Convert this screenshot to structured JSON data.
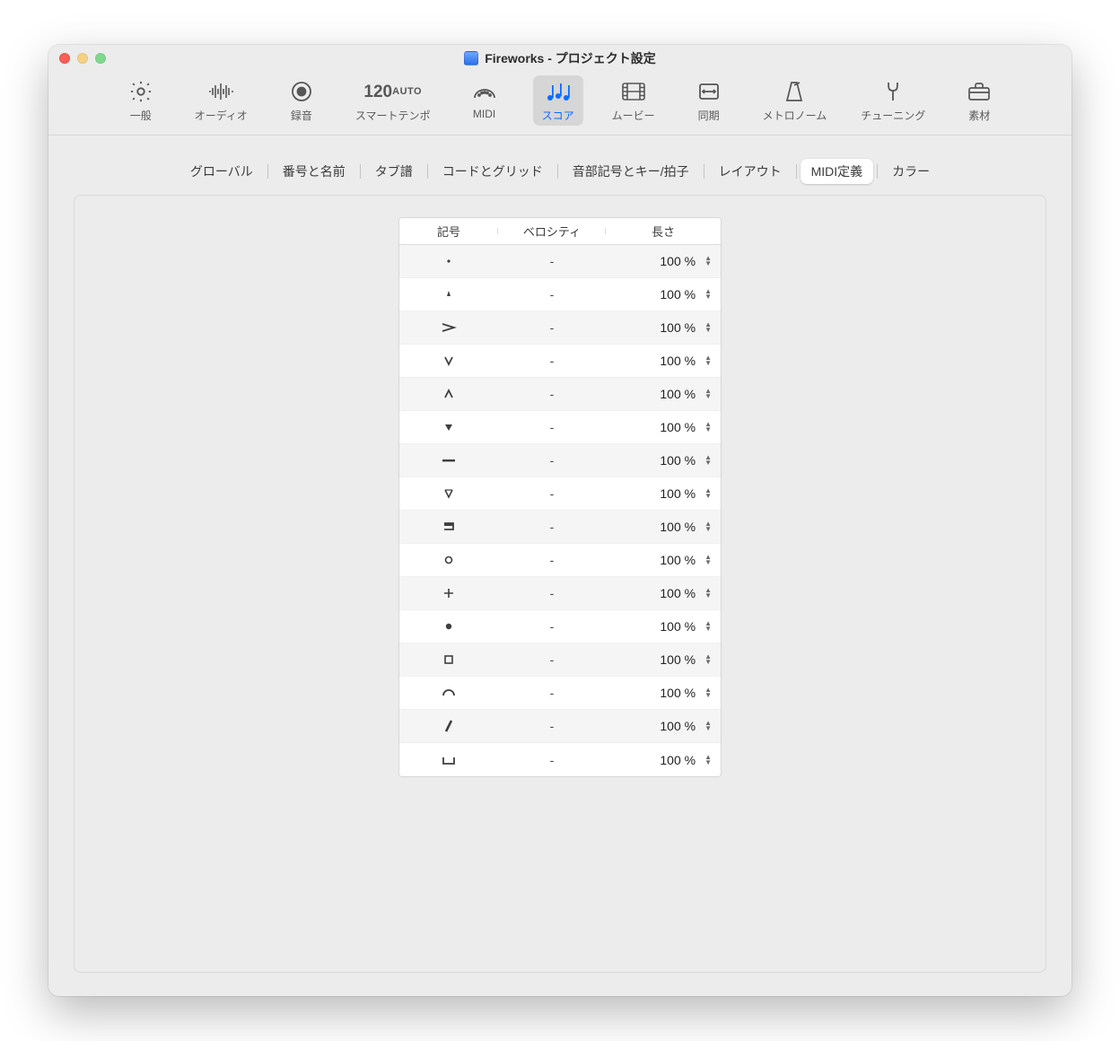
{
  "window": {
    "title": "Fireworks - プロジェクト設定"
  },
  "toolbar": {
    "items": [
      {
        "id": "general",
        "label": "一般"
      },
      {
        "id": "audio",
        "label": "オーディオ"
      },
      {
        "id": "record",
        "label": "録音"
      },
      {
        "id": "smart-tempo",
        "label": "スマートテンポ",
        "tempo": "120",
        "mode": "AUTO"
      },
      {
        "id": "midi",
        "label": "MIDI"
      },
      {
        "id": "score",
        "label": "スコア",
        "selected": true
      },
      {
        "id": "movie",
        "label": "ムービー"
      },
      {
        "id": "sync",
        "label": "同期"
      },
      {
        "id": "metronome",
        "label": "メトロノーム"
      },
      {
        "id": "tuning",
        "label": "チューニング"
      },
      {
        "id": "assets",
        "label": "素材"
      }
    ]
  },
  "subtabs": [
    {
      "label": "グローバル"
    },
    {
      "label": "番号と名前"
    },
    {
      "label": "タブ譜"
    },
    {
      "label": "コードとグリッド"
    },
    {
      "label": "音部記号とキー/拍子"
    },
    {
      "label": "レイアウト"
    },
    {
      "label": "MIDI定義",
      "active": true
    },
    {
      "label": "カラー"
    }
  ],
  "table": {
    "headers": {
      "symbol": "記号",
      "velocity": "ベロシティ",
      "length": "長さ"
    },
    "rows": [
      {
        "symbol": "staccato-dot",
        "velocity": "-",
        "length": "100 %"
      },
      {
        "symbol": "staccatissimo",
        "velocity": "-",
        "length": "100 %"
      },
      {
        "symbol": "accent",
        "velocity": "-",
        "length": "100 %"
      },
      {
        "symbol": "strong-accent-down",
        "velocity": "-",
        "length": "100 %"
      },
      {
        "symbol": "strong-accent-up",
        "velocity": "-",
        "length": "100 %"
      },
      {
        "symbol": "accent-filled-down",
        "velocity": "-",
        "length": "100 %"
      },
      {
        "symbol": "tenuto",
        "velocity": "-",
        "length": "100 %"
      },
      {
        "symbol": "down-bow-outline",
        "velocity": "-",
        "length": "100 %"
      },
      {
        "symbol": "down-bow",
        "velocity": "-",
        "length": "100 %"
      },
      {
        "symbol": "harmonic-circle",
        "velocity": "-",
        "length": "100 %"
      },
      {
        "symbol": "plus-stopped",
        "velocity": "-",
        "length": "100 %"
      },
      {
        "symbol": "filled-dot",
        "velocity": "-",
        "length": "100 %"
      },
      {
        "symbol": "open-square",
        "velocity": "-",
        "length": "100 %"
      },
      {
        "symbol": "fermata-arc",
        "velocity": "-",
        "length": "100 %"
      },
      {
        "symbol": "tremolo-slash",
        "velocity": "-",
        "length": "100 %"
      },
      {
        "symbol": "pedal-bracket",
        "velocity": "-",
        "length": "100 %"
      }
    ]
  }
}
